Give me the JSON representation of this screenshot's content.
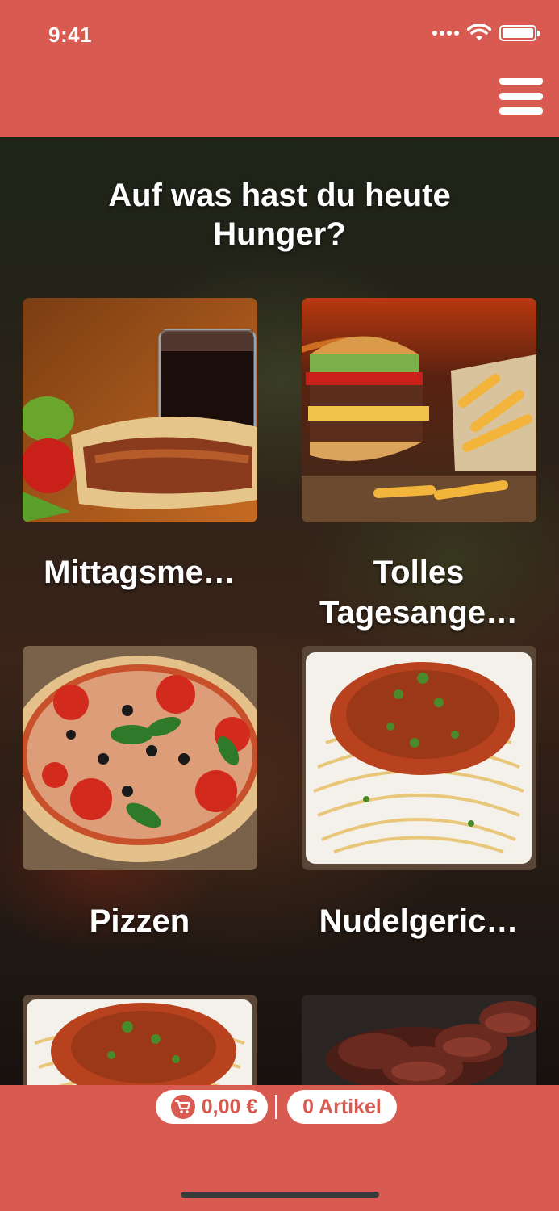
{
  "status_bar": {
    "time": "9:41",
    "icons": [
      "signal-icon",
      "wifi-icon",
      "battery-icon"
    ]
  },
  "header": {
    "menu_icon": "hamburger-menu-icon"
  },
  "main": {
    "headline": "Auf was hast du heute Hunger?",
    "categories": [
      {
        "label": "Mittagsme…",
        "image": "doner-kebab-with-cola"
      },
      {
        "label": "Tolles\nTagesange…",
        "image": "burger-with-fries"
      },
      {
        "label": "Pizzen",
        "image": "pizza"
      },
      {
        "label": "Nudelgeric…",
        "image": "spaghetti-bolognese"
      },
      {
        "label": "",
        "image": "pasta-dish"
      },
      {
        "label": "",
        "image": "grilled-steak"
      }
    ]
  },
  "footer": {
    "price": "0,00 €",
    "items": "0 Artikel",
    "icons": [
      "cart-icon"
    ]
  },
  "colors": {
    "brand": "#d85a50",
    "text_on_brand": "#ffffff"
  }
}
